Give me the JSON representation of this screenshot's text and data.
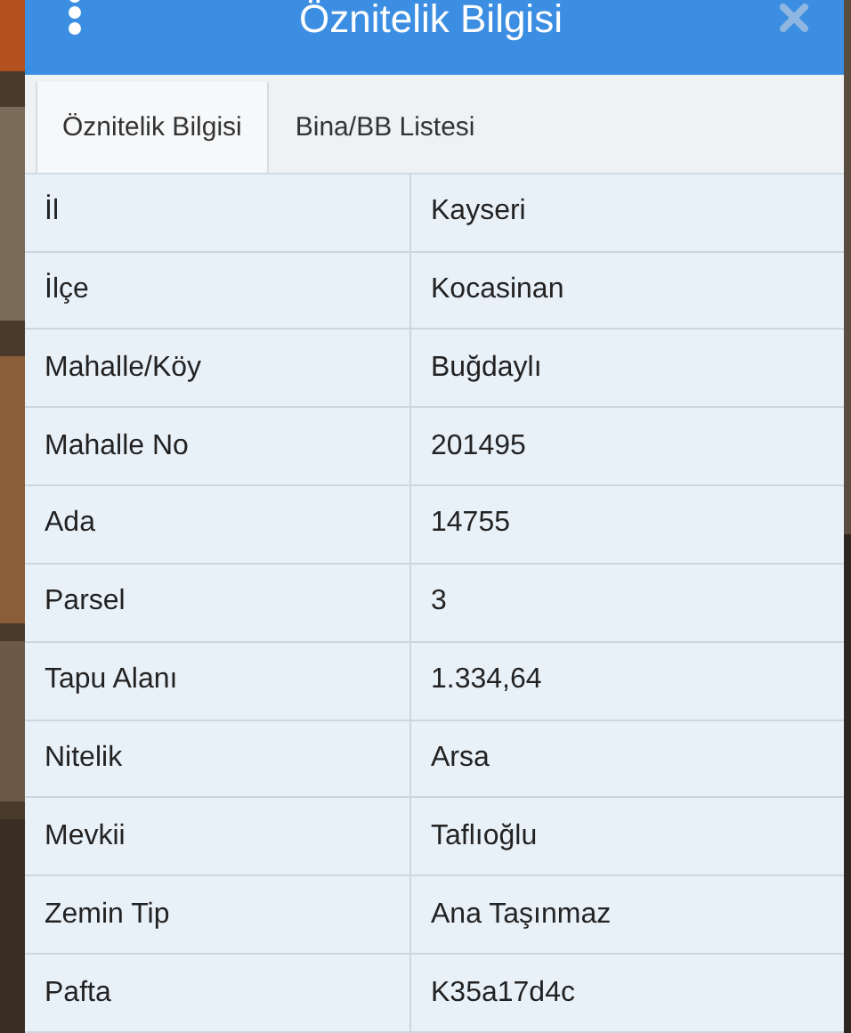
{
  "window": {
    "title": "Öznitelik Bilgisi"
  },
  "tabs": [
    {
      "label": "Öznitelik Bilgisi",
      "selected": true
    },
    {
      "label": "Bina/BB Listesi",
      "selected": false
    }
  ],
  "table": {
    "rows": [
      {
        "name": "İl",
        "value": "Kayseri"
      },
      {
        "name": "İlçe",
        "value": "Kocasinan"
      },
      {
        "name": "Mahalle/Köy",
        "value": "Buğdaylı"
      },
      {
        "name": "Mahalle No",
        "value": "201495"
      },
      {
        "name": "Ada",
        "value": "14755"
      },
      {
        "name": "Parsel",
        "value": "3"
      },
      {
        "name": "Tapu Alanı",
        "value": "1.334,64"
      },
      {
        "name": "Nitelik",
        "value": "Arsa"
      },
      {
        "name": "Mevkii",
        "value": "Taflıoğlu"
      },
      {
        "name": "Zemin Tip",
        "value": "Ana Taşınmaz"
      },
      {
        "name": "Pafta",
        "value": "K35a17d4c"
      }
    ]
  }
}
